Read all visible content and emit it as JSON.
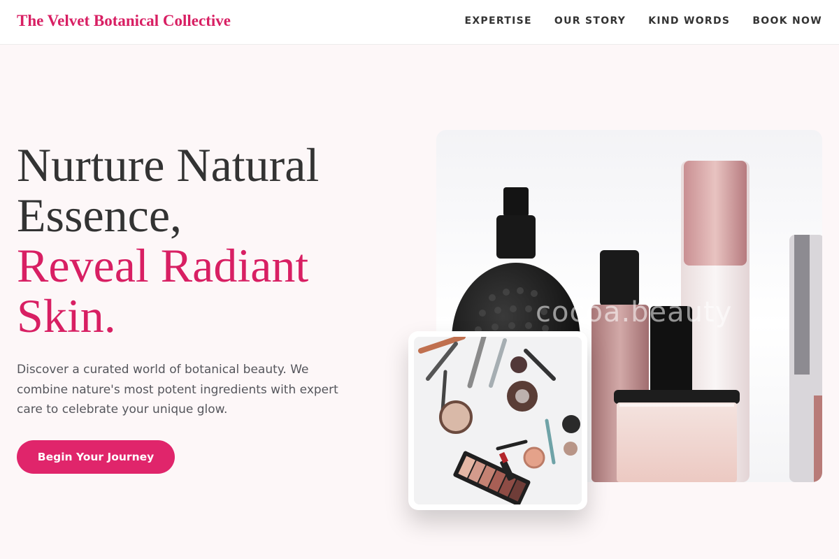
{
  "brand": {
    "name": "The Velvet Botanical Collective"
  },
  "nav": {
    "items": [
      {
        "label": "EXPERTISE"
      },
      {
        "label": "OUR STORY"
      },
      {
        "label": "KIND WORDS"
      },
      {
        "label": "BOOK NOW"
      }
    ]
  },
  "hero": {
    "title_line1": "Nurture Natural",
    "title_line2": "Essence,",
    "title_accent_line1": "Reveal Radiant",
    "title_accent_line2": "Skin.",
    "description": "Discover a curated world of botanical beauty. We combine nature's most potent ingredients with expert care to celebrate your unique glow.",
    "cta_label": "Begin Your Journey"
  },
  "images": {
    "main_watermark": "cocoa.beauty"
  },
  "colors": {
    "accent": "#d81f63",
    "button": "#e0256b",
    "background": "#fdf7f8"
  }
}
